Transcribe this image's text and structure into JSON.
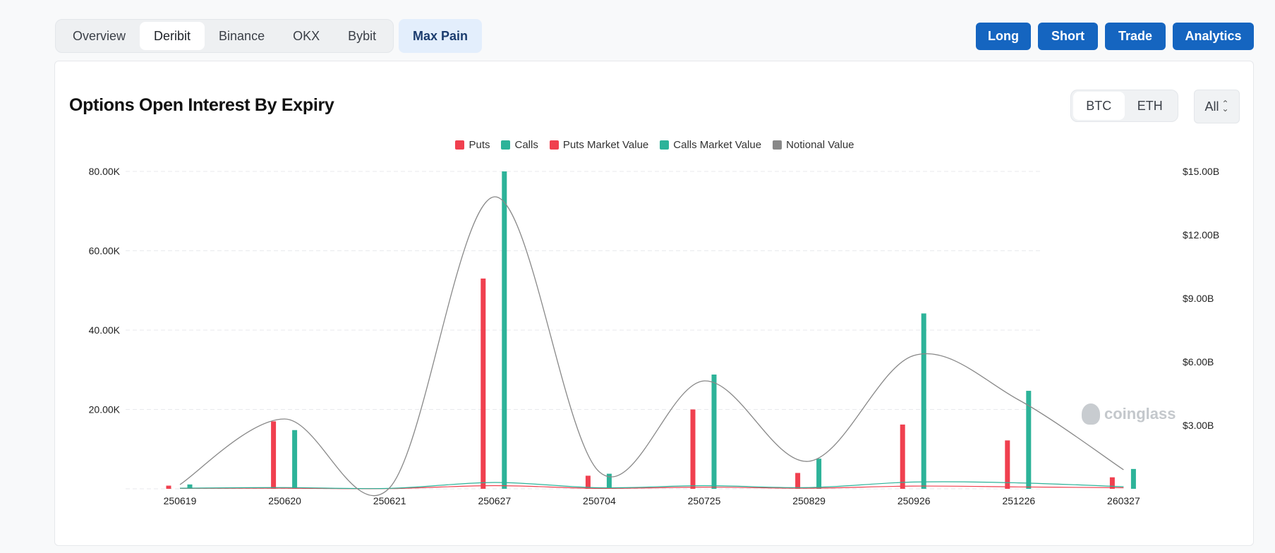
{
  "topbar": {
    "exchange_tabs": [
      {
        "label": "Overview",
        "active": false
      },
      {
        "label": "Deribit",
        "active": true
      },
      {
        "label": "Binance",
        "active": false
      },
      {
        "label": "OKX",
        "active": false
      },
      {
        "label": "Bybit",
        "active": false
      }
    ],
    "max_pain_label": "Max Pain",
    "actions": [
      "Long",
      "Short",
      "Trade",
      "Analytics"
    ]
  },
  "card": {
    "title": "Options Open Interest By Expiry",
    "coins": [
      {
        "label": "BTC",
        "active": true
      },
      {
        "label": "ETH",
        "active": false
      }
    ],
    "range_label": "All"
  },
  "colors": {
    "puts": "#f0404f",
    "calls": "#2db399",
    "notional": "#888888",
    "accent": "#1565c0"
  },
  "watermark": "coinglass",
  "chart_data": {
    "type": "bar",
    "title": "Options Open Interest By Expiry",
    "categories": [
      "250619",
      "250620",
      "250621",
      "250627",
      "250704",
      "250725",
      "250829",
      "250926",
      "251226",
      "260327"
    ],
    "legend": [
      {
        "name": "Puts",
        "color": "#f0404f"
      },
      {
        "name": "Calls",
        "color": "#2db399"
      },
      {
        "name": "Puts Market Value",
        "color": "#f0404f"
      },
      {
        "name": "Calls Market Value",
        "color": "#2db399"
      },
      {
        "name": "Notional Value",
        "color": "#888888"
      }
    ],
    "left_axis": {
      "ticks": [
        "20.00K",
        "40.00K",
        "60.00K",
        "80.00K"
      ],
      "tick_values": [
        20000,
        40000,
        60000,
        80000
      ],
      "min": 0,
      "max": 80000
    },
    "right_axis": {
      "ticks": [
        "$3.00B",
        "$6.00B",
        "$9.00B",
        "$12.00B",
        "$15.00B"
      ],
      "tick_values": [
        3,
        6,
        9,
        12,
        15
      ],
      "min": 0,
      "max": 15,
      "unit": "billion USD"
    },
    "series": [
      {
        "name": "Puts",
        "kind": "bar",
        "axis": "left",
        "values": [
          800,
          17000,
          0,
          53000,
          3300,
          20000,
          4000,
          16200,
          12200,
          2900
        ]
      },
      {
        "name": "Calls",
        "kind": "bar",
        "axis": "left",
        "values": [
          1100,
          14800,
          0,
          80000,
          3800,
          28800,
          7600,
          44200,
          24700,
          5000
        ]
      },
      {
        "name": "Puts Market Value",
        "kind": "line",
        "axis": "right",
        "values": [
          0.02,
          0.03,
          0.01,
          0.15,
          0.02,
          0.08,
          0.03,
          0.13,
          0.09,
          0.05
        ]
      },
      {
        "name": "Calls Market Value",
        "kind": "line",
        "axis": "right",
        "values": [
          0.03,
          0.06,
          0.02,
          0.3,
          0.05,
          0.15,
          0.06,
          0.32,
          0.28,
          0.1
        ]
      },
      {
        "name": "Notional Value",
        "kind": "line",
        "axis": "right",
        "values": [
          0.2,
          3.3,
          0.05,
          13.8,
          0.8,
          5.1,
          1.3,
          6.3,
          4.2,
          0.9
        ]
      }
    ],
    "grid": true,
    "legend_position": "top-center"
  }
}
